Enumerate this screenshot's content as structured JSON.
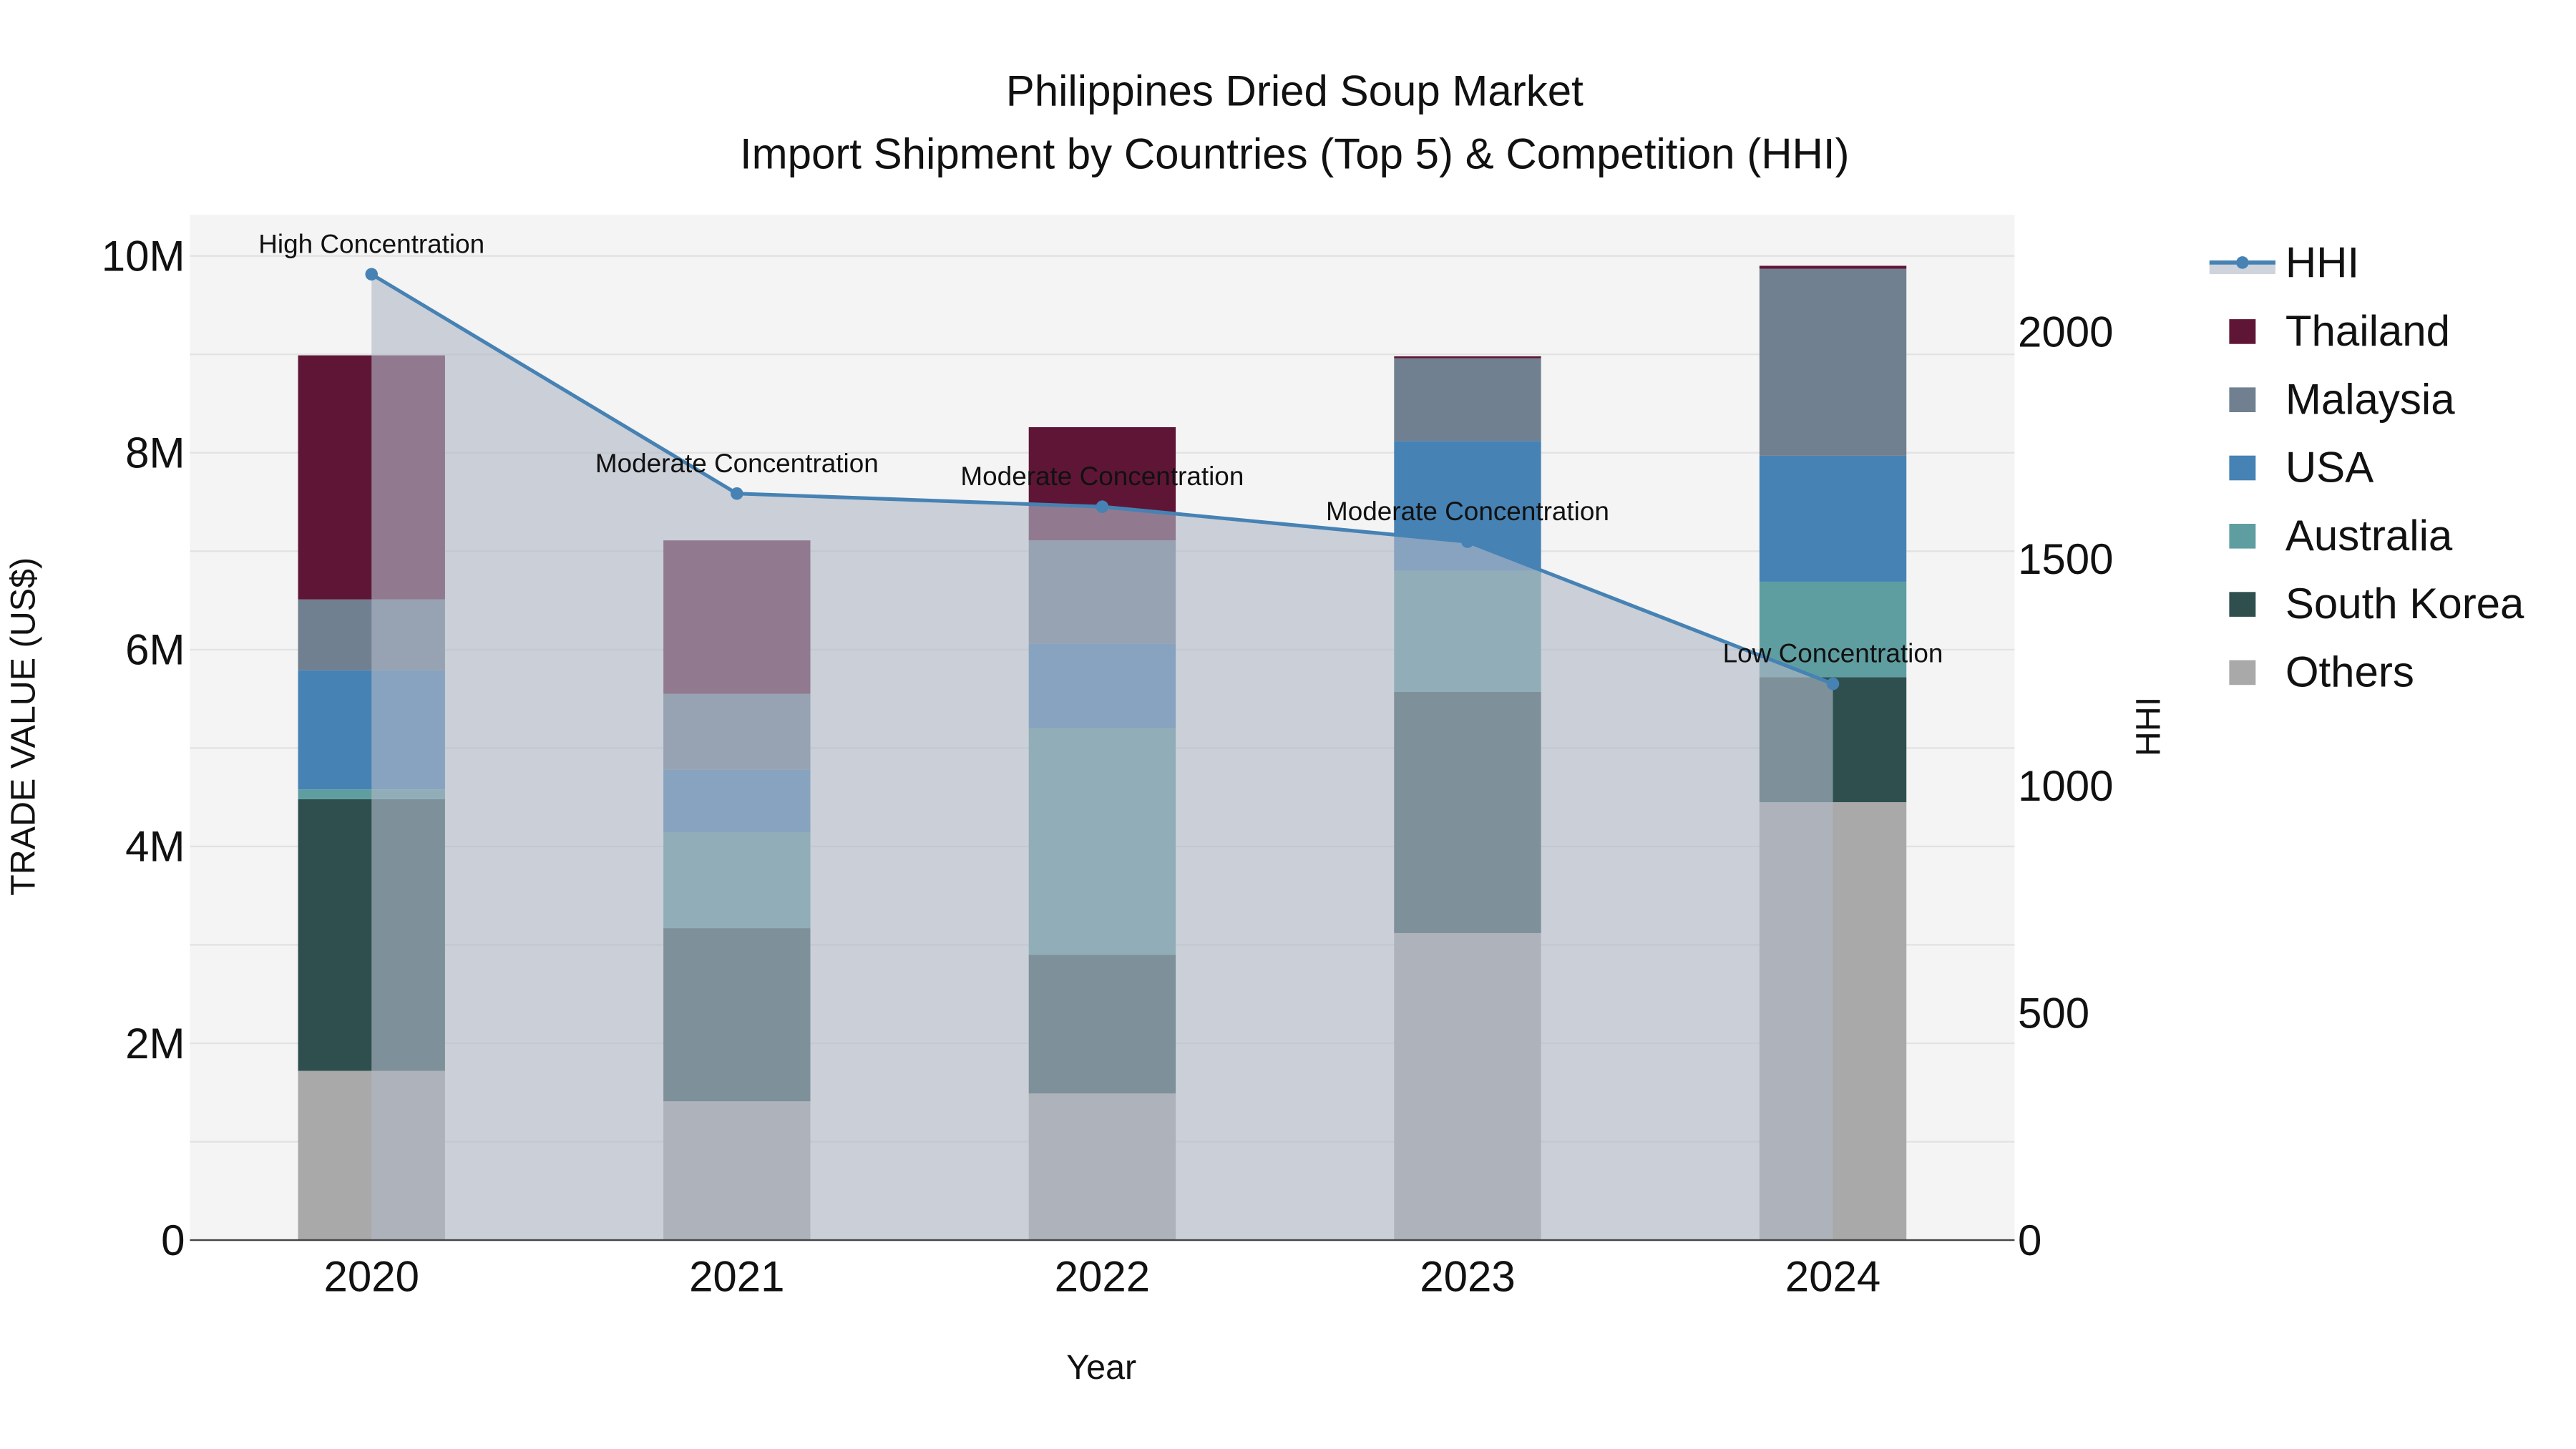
{
  "chart_data": {
    "type": "bar",
    "stacked": true,
    "title": "Philippines Dried Soup Market",
    "subtitle": "Import Shipment by Countries (Top 5) & Competition (HHI)",
    "xlabel": "Year",
    "ylabel": "TRADE VALUE (US$)",
    "y2label": "HHI",
    "categories": [
      "2020",
      "2021",
      "2022",
      "2023",
      "2024"
    ],
    "ylim": [
      0,
      10400000
    ],
    "y2lim": [
      0,
      2260
    ],
    "yticks": [
      {
        "v": 0,
        "label": "0"
      },
      {
        "v": 2000000,
        "label": "2M"
      },
      {
        "v": 4000000,
        "label": "4M"
      },
      {
        "v": 6000000,
        "label": "6M"
      },
      {
        "v": 8000000,
        "label": "8M"
      },
      {
        "v": 10000000,
        "label": "10M"
      }
    ],
    "y2ticks": [
      {
        "v": 0,
        "label": "0"
      },
      {
        "v": 500,
        "label": "500"
      },
      {
        "v": 1000,
        "label": "1000"
      },
      {
        "v": 1500,
        "label": "1500"
      },
      {
        "v": 2000,
        "label": "2000"
      }
    ],
    "grid": true,
    "legend_position": "right",
    "series": [
      {
        "name": "Others",
        "color": "#a9a9a9",
        "values": [
          1720000,
          1410000,
          1490000,
          3120000,
          4450000
        ]
      },
      {
        "name": "South Korea",
        "color": "#2f4f4f",
        "values": [
          2760000,
          1760000,
          1410000,
          2450000,
          1270000
        ]
      },
      {
        "name": "Australia",
        "color": "#5f9ea0",
        "values": [
          100000,
          970000,
          2300000,
          1230000,
          970000
        ]
      },
      {
        "name": "USA",
        "color": "#4682b4",
        "values": [
          1210000,
          640000,
          860000,
          1320000,
          1280000
        ]
      },
      {
        "name": "Malaysia",
        "color": "#708090",
        "values": [
          720000,
          770000,
          1050000,
          840000,
          1900000
        ]
      },
      {
        "name": "Thailand",
        "color": "#5f1636",
        "values": [
          2480000,
          1560000,
          1150000,
          20000,
          30000
        ]
      }
    ],
    "hhi": {
      "name": "HHI",
      "color": "#4682b4",
      "values": [
        2127,
        1644,
        1615,
        1538,
        1225
      ],
      "annotations": [
        "High Concentration",
        "Moderate Concentration",
        "Moderate Concentration",
        "Moderate Concentration",
        "Low Concentration"
      ]
    },
    "legend_order": [
      "HHI",
      "Thailand",
      "Malaysia",
      "USA",
      "Australia",
      "South Korea",
      "Others"
    ]
  }
}
